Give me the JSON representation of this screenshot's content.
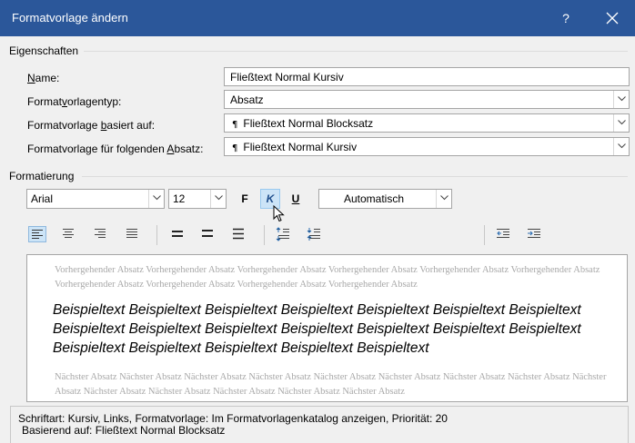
{
  "window": {
    "title": "Formatvorlage ändern",
    "help_label": "?",
    "close_icon": "close-icon",
    "titlebar_color": "#2b579a"
  },
  "properties": {
    "group_label": "Eigenschaften",
    "name": {
      "label_pre": "",
      "label_ul": "N",
      "label_post": "ame:",
      "value": "Fließtext Normal Kursiv"
    },
    "type": {
      "label_pre": "Format",
      "label_ul": "v",
      "label_post": "orlagentyp:",
      "value": "Absatz"
    },
    "based_on": {
      "label_pre": "Formatvorlage ",
      "label_ul": "b",
      "label_post": "asiert auf:",
      "value": "Fließtext Normal Blocksatz",
      "icon": "¶"
    },
    "next": {
      "label_pre": "Formatvorlage für folgenden ",
      "label_ul": "A",
      "label_post": "bsatz:",
      "value": "Fließtext Normal Kursiv",
      "icon": "¶"
    }
  },
  "formatting": {
    "group_label": "Formatierung",
    "font": "Arial",
    "size": "12",
    "bold": "F",
    "italic": "K",
    "underline": "U",
    "color": "Automatisch",
    "active_color": "#cce4f7"
  },
  "preview": {
    "previous": "Vorhergehender Absatz Vorhergehender Absatz Vorhergehender Absatz Vorhergehender Absatz Vorhergehender Absatz Vorhergehender Absatz Vorhergehender Absatz Vorhergehender Absatz Vorhergehender Absatz Vorhergehender Absatz",
    "sample": "Beispieltext Beispieltext Beispieltext Beispieltext Beispieltext Beispieltext Beispieltext Beispieltext Beispieltext Beispieltext Beispieltext Beispieltext Beispieltext Beispieltext Beispieltext Beispieltext Beispieltext Beispieltext Beispieltext",
    "next": "Nächster Absatz Nächster Absatz Nächster Absatz Nächster Absatz Nächster Absatz Nächster Absatz Nächster Absatz Nächster Absatz Nächster Absatz Nächster Absatz Nächster Absatz Nächster Absatz Nächster Absatz Nächster Absatz"
  },
  "description": {
    "line1": "Schriftart: Kursiv, Links, Formatvorlage: Im Formatvorlagenkatalog anzeigen, Priorität: 20",
    "line2": "Basierend auf: Fließtext Normal Blocksatz"
  }
}
